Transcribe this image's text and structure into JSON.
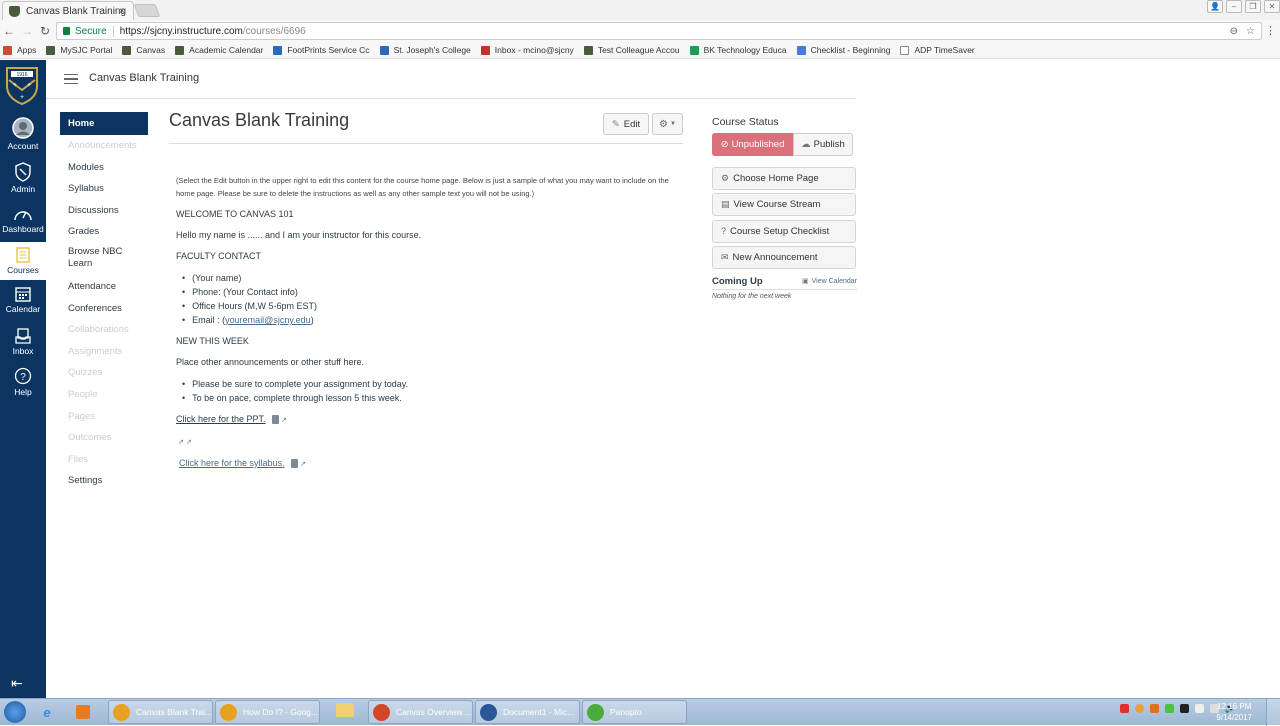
{
  "browser": {
    "tab_title": "Canvas Blank Training",
    "tab_close": "×",
    "secure_label": "Secure",
    "url_scheme_host": "https://sjcny.instructure.com",
    "url_path": "/courses/6696",
    "bookmarks": [
      {
        "label": "Apps",
        "color": "#d04a3a"
      },
      {
        "label": "MySJC Portal",
        "color": "#4a5a3a"
      },
      {
        "label": "Canvas",
        "color": "#4a5a3a"
      },
      {
        "label": "Academic Calendar",
        "color": "#4a5a3a"
      },
      {
        "label": "FootPrints Service Cc",
        "color": "#2a6ab8"
      },
      {
        "label": "St. Joseph's College",
        "color": "#2a6ab8"
      },
      {
        "label": "Inbox - mcino@sjcny",
        "color": "#c8302a"
      },
      {
        "label": "Test Colleague Accou",
        "color": "#4a5a3a"
      },
      {
        "label": "BK Technology Educa",
        "color": "#1f9d55"
      },
      {
        "label": "Checklist - Beginning",
        "color": "#4a7ad8"
      },
      {
        "label": "ADP TimeSaver",
        "color": "#ffffff"
      }
    ]
  },
  "global_nav": {
    "items": [
      {
        "label": "Account"
      },
      {
        "label": "Admin"
      },
      {
        "label": "Dashboard"
      },
      {
        "label": "Courses"
      },
      {
        "label": "Calendar"
      },
      {
        "label": "Inbox"
      },
      {
        "label": "Help"
      }
    ],
    "logo_year": "1916"
  },
  "header": {
    "breadcrumb_title": "Canvas Blank Training"
  },
  "course_nav": {
    "items": [
      {
        "label": "Home",
        "state": "active"
      },
      {
        "label": "Announcements",
        "state": "disabled"
      },
      {
        "label": "Modules",
        "state": "enabled"
      },
      {
        "label": "Syllabus",
        "state": "enabled"
      },
      {
        "label": "Discussions",
        "state": "enabled"
      },
      {
        "label": "Grades",
        "state": "enabled"
      },
      {
        "label": "Browse NBC Learn",
        "state": "enabled"
      },
      {
        "label": "Attendance",
        "state": "enabled"
      },
      {
        "label": "Conferences",
        "state": "enabled"
      },
      {
        "label": "Collaborations",
        "state": "disabled"
      },
      {
        "label": "Assignments",
        "state": "disabled"
      },
      {
        "label": "Quizzes",
        "state": "disabled"
      },
      {
        "label": "People",
        "state": "disabled"
      },
      {
        "label": "Pages",
        "state": "disabled"
      },
      {
        "label": "Outcomes",
        "state": "disabled"
      },
      {
        "label": "Files",
        "state": "disabled"
      },
      {
        "label": "Settings",
        "state": "enabled"
      }
    ]
  },
  "main": {
    "title": "Canvas Blank Training",
    "edit_label": "Edit",
    "instructions": "(Select the Edit button in the upper right to edit this content for the course home page.  Below is just a sample of what you may want to include on the home page.  Please be sure to delete the instructions as well as any other sample text you will not be using.)",
    "welcome_heading": "WELCOME TO CANVAS 101",
    "intro": "Hello my name is ...... and I am your instructor for this course.",
    "faculty_heading": "FACULTY CONTACT",
    "faculty_items": {
      "name": "(Your name)",
      "phone": "Phone: (Your Contact info)",
      "hours": "Office Hours (M,W 5-6pm EST)",
      "email_prefix": "Email : (",
      "email_link": "youremail@sjcny.edu",
      "email_suffix": ")"
    },
    "new_heading": "NEW THIS WEEK",
    "new_intro": "Place other announcements or other stuff here.",
    "new_items": [
      "Please be sure to complete your assignment by today.",
      "To be on pace, complete through lesson 5 this week."
    ],
    "ppt_link": "Click here for the PPT.",
    "syllabus_link": "Click here for the syllabus."
  },
  "aside": {
    "course_status_heading": "Course Status",
    "unpublished_label": "Unpublished",
    "publish_label": "Publish",
    "buttons": [
      {
        "label": "Choose Home Page",
        "icon": "⚙"
      },
      {
        "label": "View Course Stream",
        "icon": "▤"
      },
      {
        "label": "Course Setup Checklist",
        "icon": "?"
      },
      {
        "label": "New Announcement",
        "icon": "✉"
      }
    ],
    "coming_up_heading": "Coming Up",
    "view_calendar_label": "View Calendar",
    "nothing_text": "Nothing for the next week",
    "unpublished_color": "#d9707a",
    "brand_color": "#0c3461"
  },
  "taskbar": {
    "tasks": [
      {
        "label": "Canvas Blank Trai...",
        "color": "#e8a020"
      },
      {
        "label": "How Do I? - Goog...",
        "color": "#e8a020"
      },
      {
        "label": "Canvas Overview ...",
        "color": "#d24726"
      },
      {
        "label": "Document1 - Mic...",
        "color": "#2b5797"
      },
      {
        "label": "Panopto",
        "color": "#4caa3c"
      }
    ],
    "clock_time": "12:16 PM",
    "clock_date": "9/14/2017"
  }
}
